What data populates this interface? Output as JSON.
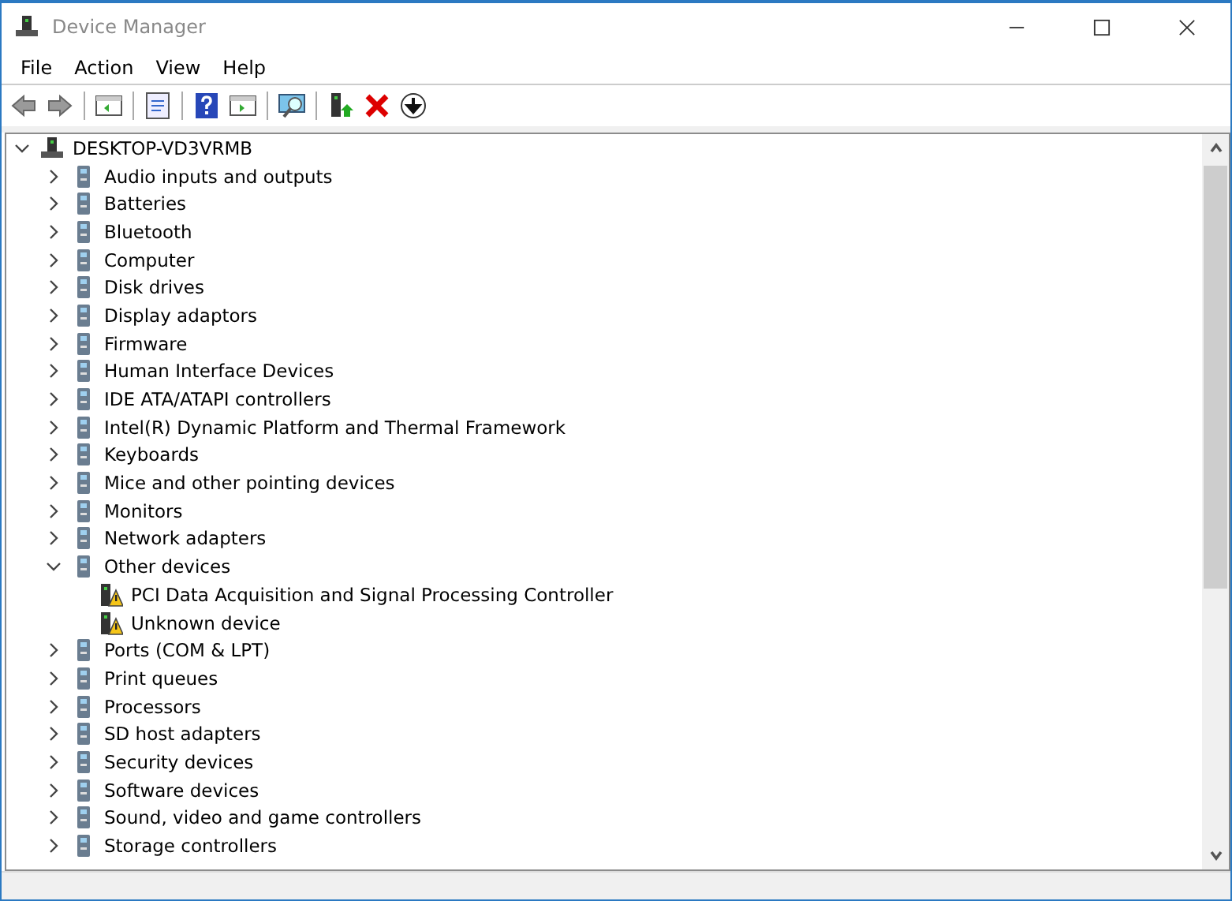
{
  "window": {
    "title": "Device Manager"
  },
  "menu": [
    "File",
    "Action",
    "View",
    "Help"
  ],
  "tree": {
    "label": "DESKTOP-VD3VRMB",
    "expanded": true,
    "children": [
      {
        "label": "Audio inputs and outputs",
        "expanded": false
      },
      {
        "label": "Batteries",
        "expanded": false
      },
      {
        "label": "Bluetooth",
        "expanded": false
      },
      {
        "label": "Computer",
        "expanded": false
      },
      {
        "label": "Disk drives",
        "expanded": false
      },
      {
        "label": "Display adaptors",
        "expanded": false
      },
      {
        "label": "Firmware",
        "expanded": false
      },
      {
        "label": "Human Interface Devices",
        "expanded": false
      },
      {
        "label": "IDE ATA/ATAPI controllers",
        "expanded": false
      },
      {
        "label": "Intel(R) Dynamic Platform and Thermal Framework",
        "expanded": false
      },
      {
        "label": "Keyboards",
        "expanded": false
      },
      {
        "label": "Mice and other pointing devices",
        "expanded": false
      },
      {
        "label": "Monitors",
        "expanded": false
      },
      {
        "label": "Network adapters",
        "expanded": false
      },
      {
        "label": "Other devices",
        "expanded": true,
        "children": [
          {
            "label": "PCI Data Acquisition and Signal Processing Controller",
            "warning": true
          },
          {
            "label": "Unknown device",
            "warning": true
          }
        ]
      },
      {
        "label": "Ports (COM & LPT)",
        "expanded": false
      },
      {
        "label": "Print queues",
        "expanded": false
      },
      {
        "label": "Processors",
        "expanded": false
      },
      {
        "label": "SD host adapters",
        "expanded": false
      },
      {
        "label": "Security devices",
        "expanded": false
      },
      {
        "label": "Software devices",
        "expanded": false
      },
      {
        "label": "Sound, video and game controllers",
        "expanded": false
      },
      {
        "label": "Storage controllers",
        "expanded": false
      }
    ]
  }
}
